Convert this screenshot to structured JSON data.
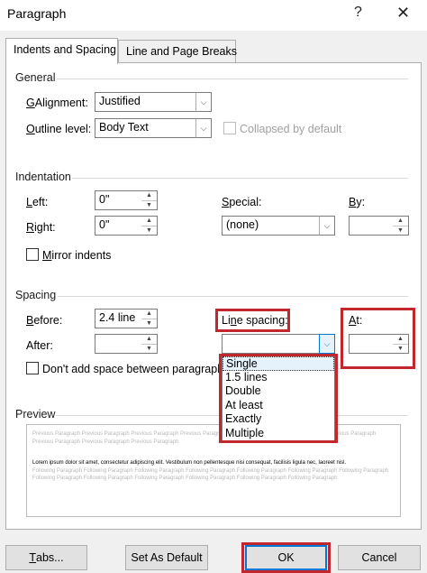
{
  "window": {
    "title": "Paragraph",
    "help_icon": "?",
    "close_icon": "✕"
  },
  "tabs": [
    {
      "label": "Indents and Spacing",
      "active": true
    },
    {
      "label": "Line and Page Breaks",
      "active": false
    }
  ],
  "general": {
    "heading": "General",
    "alignment": {
      "label_u": "G",
      "label_rest": "Alignment:",
      "value": "Justified"
    },
    "outline_level": {
      "label_u": "O",
      "label_rest": "utline level:",
      "value": "Body Text"
    },
    "collapsed": {
      "label": "Collapsed by default",
      "checked": false,
      "enabled": false
    }
  },
  "indentation": {
    "heading": "Indentation",
    "left": {
      "label_u": "L",
      "label_rest": "eft:",
      "value": "0\""
    },
    "right": {
      "label_u": "R",
      "label_rest": "ight:",
      "value": "0\""
    },
    "special": {
      "label_u": "S",
      "label_rest": "pecial:",
      "value": "(none)"
    },
    "by": {
      "label_u": "B",
      "label_rest": "y:",
      "value": ""
    },
    "mirror": {
      "label_u": "M",
      "label_rest": "irror indents",
      "checked": false
    }
  },
  "spacing": {
    "heading": "Spacing",
    "before": {
      "label_u": "B",
      "label_rest": "efore:",
      "value": "2.4 line"
    },
    "after": {
      "label_rest": "After:",
      "value": ""
    },
    "line_spacing": {
      "label_a": "Li",
      "label_u": "n",
      "label_b": "e spacing:",
      "value": ""
    },
    "at": {
      "label_u": "A",
      "label_rest": "t:",
      "value": ""
    },
    "dont_add": {
      "label": "Don't add space between paragraphs o",
      "checked": false
    },
    "line_spacing_options": [
      "Single",
      "1.5 lines",
      "Double",
      "At least",
      "Exactly",
      "Multiple"
    ],
    "highlighted_option": "Single"
  },
  "preview": {
    "heading": "Preview",
    "previous_text": "Previous Paragraph Previous Paragraph Previous Paragraph Previous Paragraph Previous Paragraph Previous Paragraph Previous Paragraph Previous Paragraph Previous Paragraph Previous Paragraph",
    "sample_text": "Lorem ipsum dolor sit amet, consectetur adipiscing elit. Vestibulum non pellentesque nisi consequat, facilisis ligula nec, laoreet nisl.",
    "following_text": "Following Paragraph Following Paragraph Following Paragraph Following Paragraph Following Paragraph Following Paragraph Following Paragraph Following Paragraph Following Paragraph Following Paragraph Following Paragraph Following Paragraph Following Paragraph"
  },
  "footer": {
    "tabs_label_u": "T",
    "tabs_label_rest": "abs...",
    "default_label": "Set As Default",
    "ok_label": "OK",
    "cancel_label": "Cancel"
  },
  "colors": {
    "highlight": "#c1272d",
    "accent": "#0078d7",
    "dialog_bg": "#f0f0f0"
  }
}
